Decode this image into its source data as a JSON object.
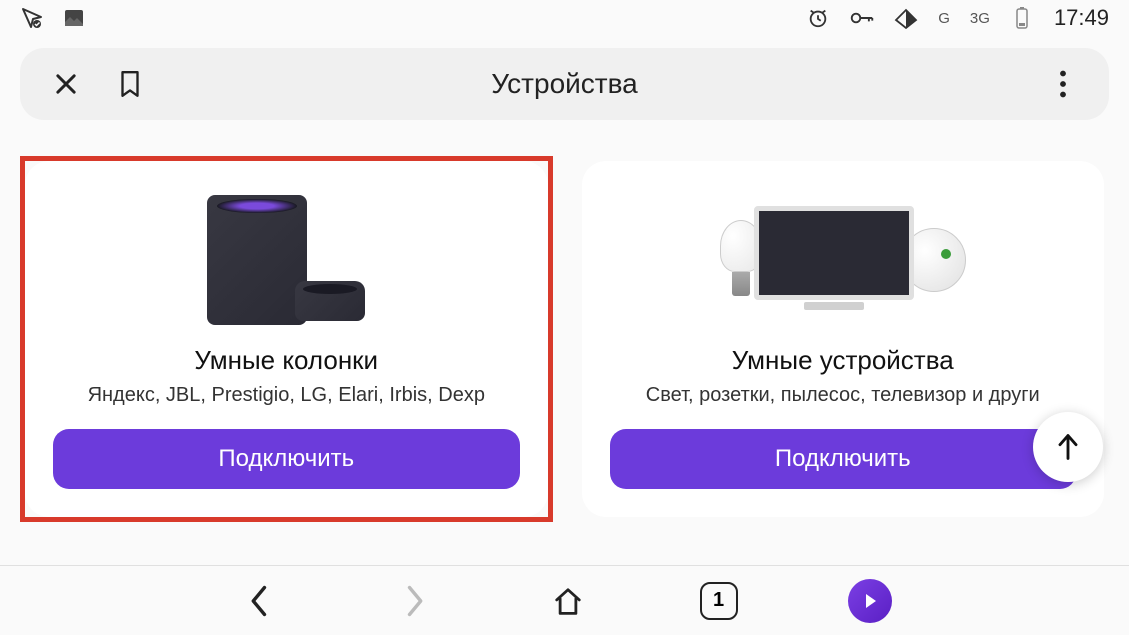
{
  "status_bar": {
    "signal_g": "G",
    "signal_3g": "3G",
    "time": "17:49"
  },
  "header": {
    "title": "Устройства"
  },
  "cards": [
    {
      "title": "Умные колонки",
      "subtitle": "Яндекс, JBL, Prestigio, LG, Elari, Irbis, Dexp",
      "button": "Подключить",
      "highlighted": true
    },
    {
      "title": "Умные устройства",
      "subtitle": "Свет, розетки, пылесос, телевизор и други",
      "button": "Подключить",
      "highlighted": false
    }
  ],
  "bottom_nav": {
    "tab_count": "1"
  }
}
